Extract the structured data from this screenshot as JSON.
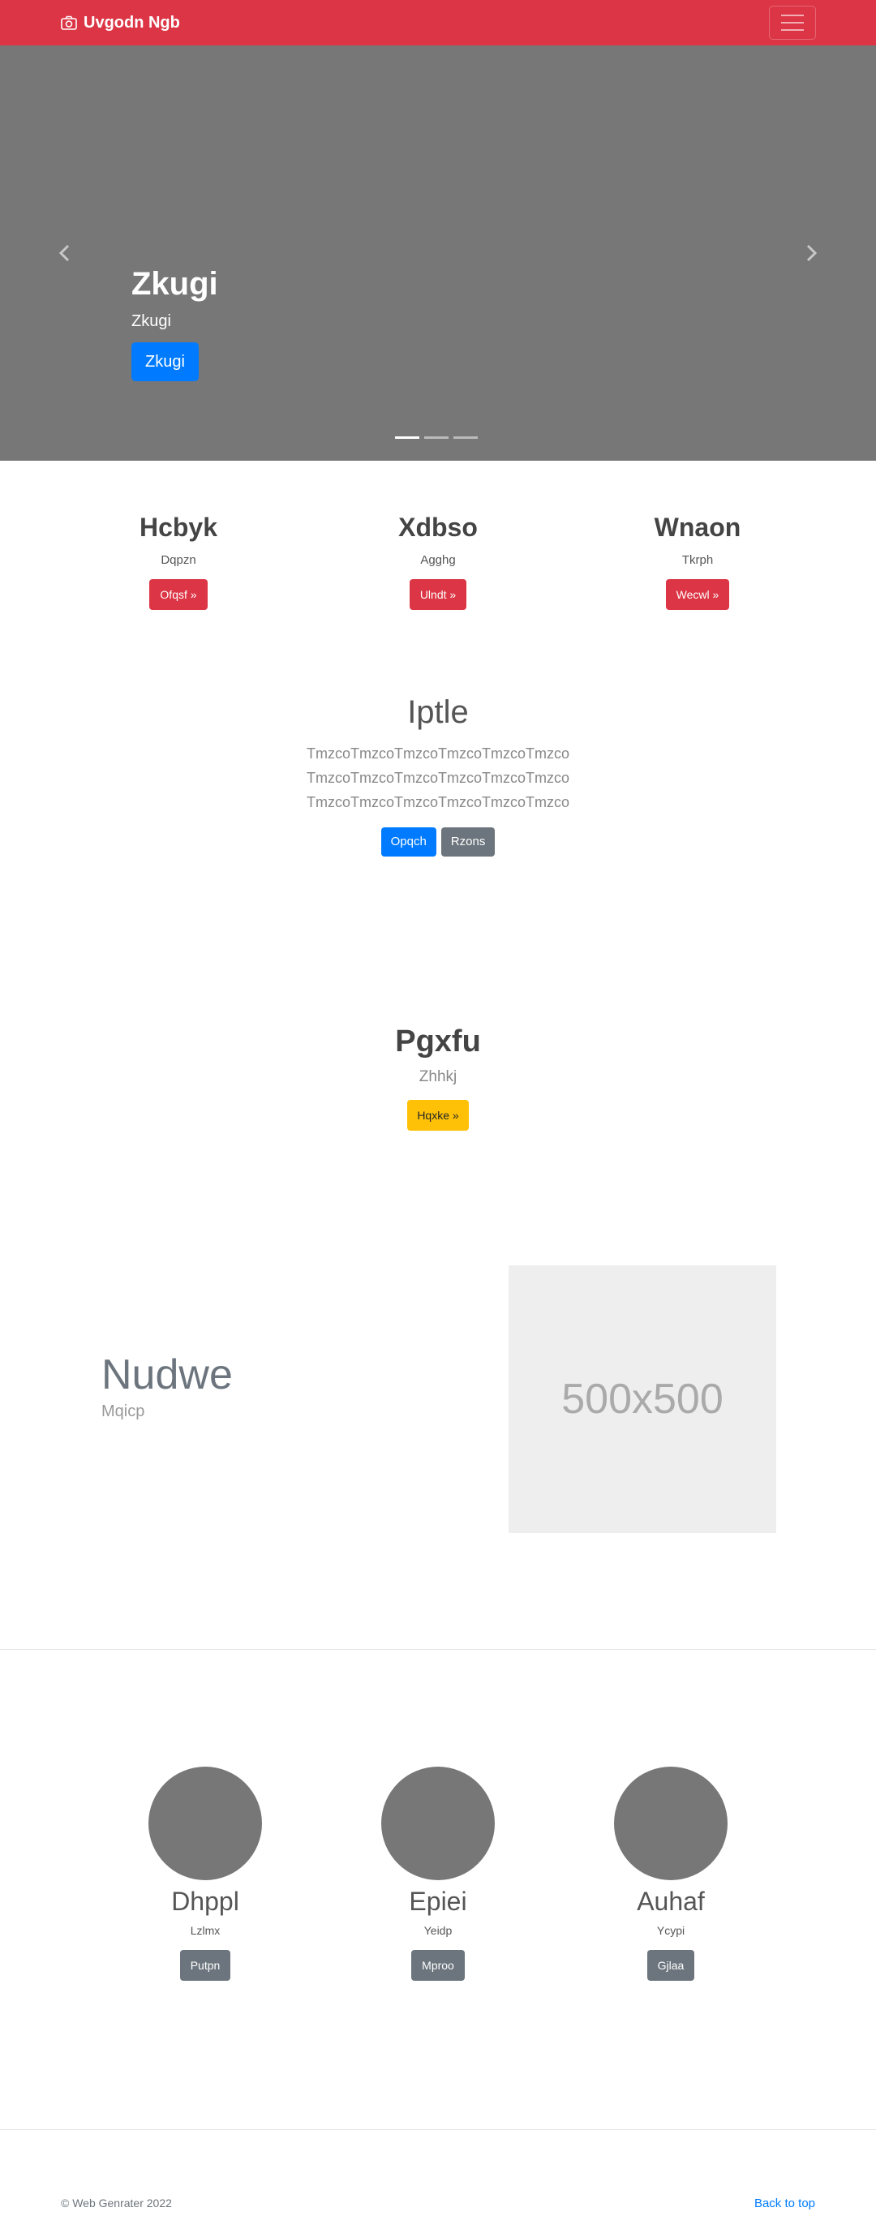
{
  "navbar": {
    "brand": "Uvgodn Ngb",
    "brand_icon": "camera-icon",
    "toggler_icon": "menu-icon"
  },
  "carousel": {
    "title": "Zkugi",
    "subtitle": "Zkugi",
    "button": "Zkugi",
    "prev_icon": "chevron-left-icon",
    "next_icon": "chevron-right-icon",
    "slides_count": 3,
    "active_slide": 1
  },
  "features": [
    {
      "title": "Hcbyk",
      "text": "Dqpzn",
      "button": "Ofqsf »"
    },
    {
      "title": "Xdbso",
      "text": "Agghg",
      "button": "Ulndt »"
    },
    {
      "title": "Wnaon",
      "text": "Tkrph",
      "button": "Wecwl »"
    }
  ],
  "intro": {
    "title": "Iptle",
    "lines": [
      "TmzcoTmzcoTmzcoTmzcoTmzcoTmzco",
      "TmzcoTmzcoTmzcoTmzcoTmzcoTmzco",
      "TmzcoTmzcoTmzcoTmzcoTmzcoTmzco"
    ],
    "primary_button": "Opqch",
    "secondary_button": "Rzons"
  },
  "callout": {
    "title": "Pgxfu",
    "text": "Zhhkj",
    "button": "Hqxke »"
  },
  "featurette": {
    "title": "Nudwe",
    "text": "Mqicp",
    "image_label": "500x500"
  },
  "team": [
    {
      "name": "Dhppl",
      "role": "Lzlmx",
      "button": "Putpn"
    },
    {
      "name": "Epiei",
      "role": "Yeidp",
      "button": "Mproo"
    },
    {
      "name": "Auhaf",
      "role": "Ycypi",
      "button": "Gjlaa"
    }
  ],
  "footer": {
    "copyright": "© Web Genrater 2022",
    "back_to_top": "Back to top"
  },
  "colors": {
    "navbar": "#dc3545",
    "primary": "#007bff",
    "secondary": "#6c757d",
    "warning": "#ffc107",
    "carousel_bg": "#777777"
  }
}
